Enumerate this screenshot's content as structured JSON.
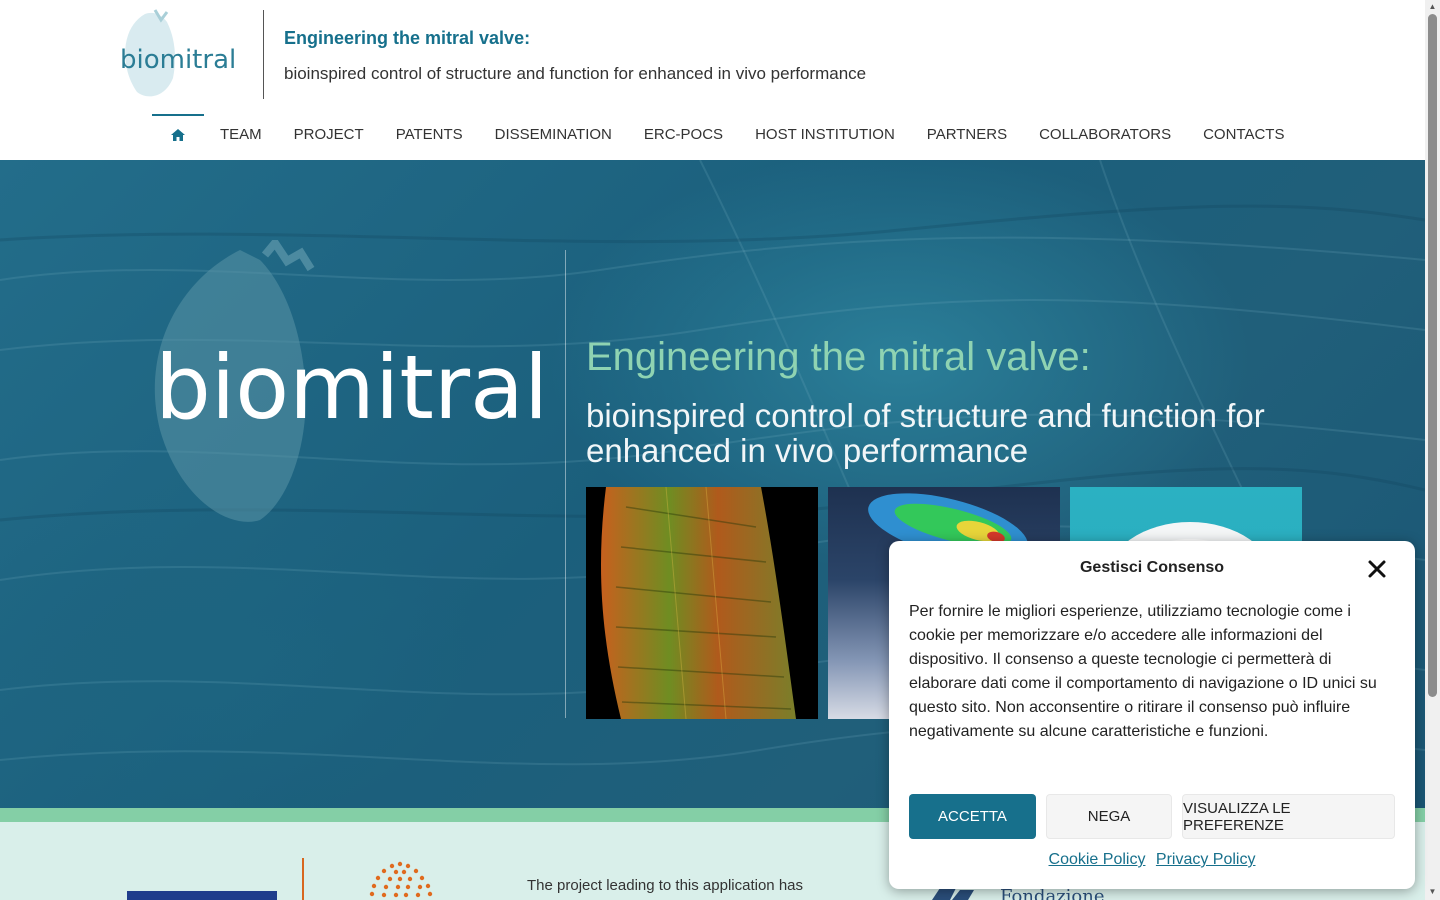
{
  "header": {
    "logo_text": "biomitral",
    "title": "Engineering the mitral valve:",
    "subtitle": "bioinspired control of structure and function for enhanced in vivo performance"
  },
  "nav": {
    "home_icon": "home-icon",
    "items": [
      "TEAM",
      "PROJECT",
      "PATENTS",
      "DISSEMINATION",
      "ERC-POCS",
      "HOST INSTITUTION",
      "PARTNERS",
      "COLLABORATORS",
      "CONTACTS"
    ]
  },
  "hero": {
    "logo_text": "biomitral",
    "title": "Engineering the mitral valve:",
    "subtitle": "bioinspired control of structure and function for enhanced in vivo performance"
  },
  "footer": {
    "text": "The project leading to this application has",
    "partner_logo_text": "Fondazione"
  },
  "cookie": {
    "title": "Gestisci Consenso",
    "body": "Per fornire le migliori esperienze, utilizziamo tecnologie come i cookie per memorizzare e/o accedere alle informazioni del dispositivo. Il consenso a queste tecnologie ci permetterà di elaborare dati come il comportamento di navigazione o ID unici su questo sito. Non acconsentire o ritirare il consenso può influire negativamente su alcune caratteristiche e funzioni.",
    "accept_label": "ACCETTA",
    "deny_label": "NEGA",
    "prefs_label": "VISUALIZZA LE PREFERENZE",
    "cookie_policy_label": "Cookie Policy",
    "privacy_policy_label": "Privacy Policy"
  },
  "colors": {
    "brand": "#16708c",
    "hero_title": "#8fd3b2",
    "band": "#84cfa6"
  }
}
